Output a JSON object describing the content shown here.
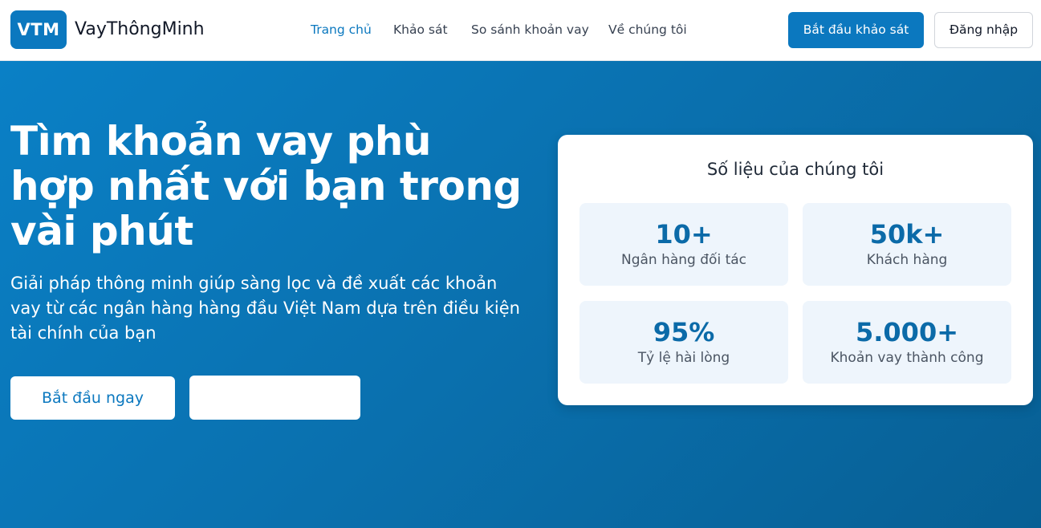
{
  "header": {
    "logo_badge": "VTM",
    "brand_name": "VayThôngMinh",
    "nav": [
      {
        "label": "Trang chủ",
        "active": true
      },
      {
        "label": "Khảo sát",
        "active": false
      },
      {
        "label": "So sánh khoản vay",
        "active": false
      },
      {
        "label": "Về chúng tôi",
        "active": false
      }
    ],
    "start_survey_label": "Bắt đầu khảo sát",
    "login_label": "Đăng nhập"
  },
  "hero": {
    "title": "Tìm khoản vay phù hợp nhất với bạn trong vài phút",
    "subtitle": "Giải pháp thông minh giúp sàng lọc và đề xuất các khoản vay từ các ngân hàng hàng đầu Việt Nam dựa trên điều kiện tài chính của bạn",
    "primary_button_label": "Bắt đầu ngay",
    "secondary_button_label": ""
  },
  "stats": {
    "title": "Số liệu của chúng tôi",
    "items": [
      {
        "value": "10+",
        "label": "Ngân hàng đối tác"
      },
      {
        "value": "50k+",
        "label": "Khách hàng"
      },
      {
        "value": "95%",
        "label": "Tỷ lệ hài lòng"
      },
      {
        "value": "5.000+",
        "label": "Khoản vay thành công"
      }
    ]
  },
  "colors": {
    "brand": "#0b78bf",
    "hero_gradient_start": "#0a80c6",
    "hero_gradient_end": "#075f94",
    "stat_box_bg": "#eef5fc",
    "stat_value": "#0b6aa8"
  }
}
